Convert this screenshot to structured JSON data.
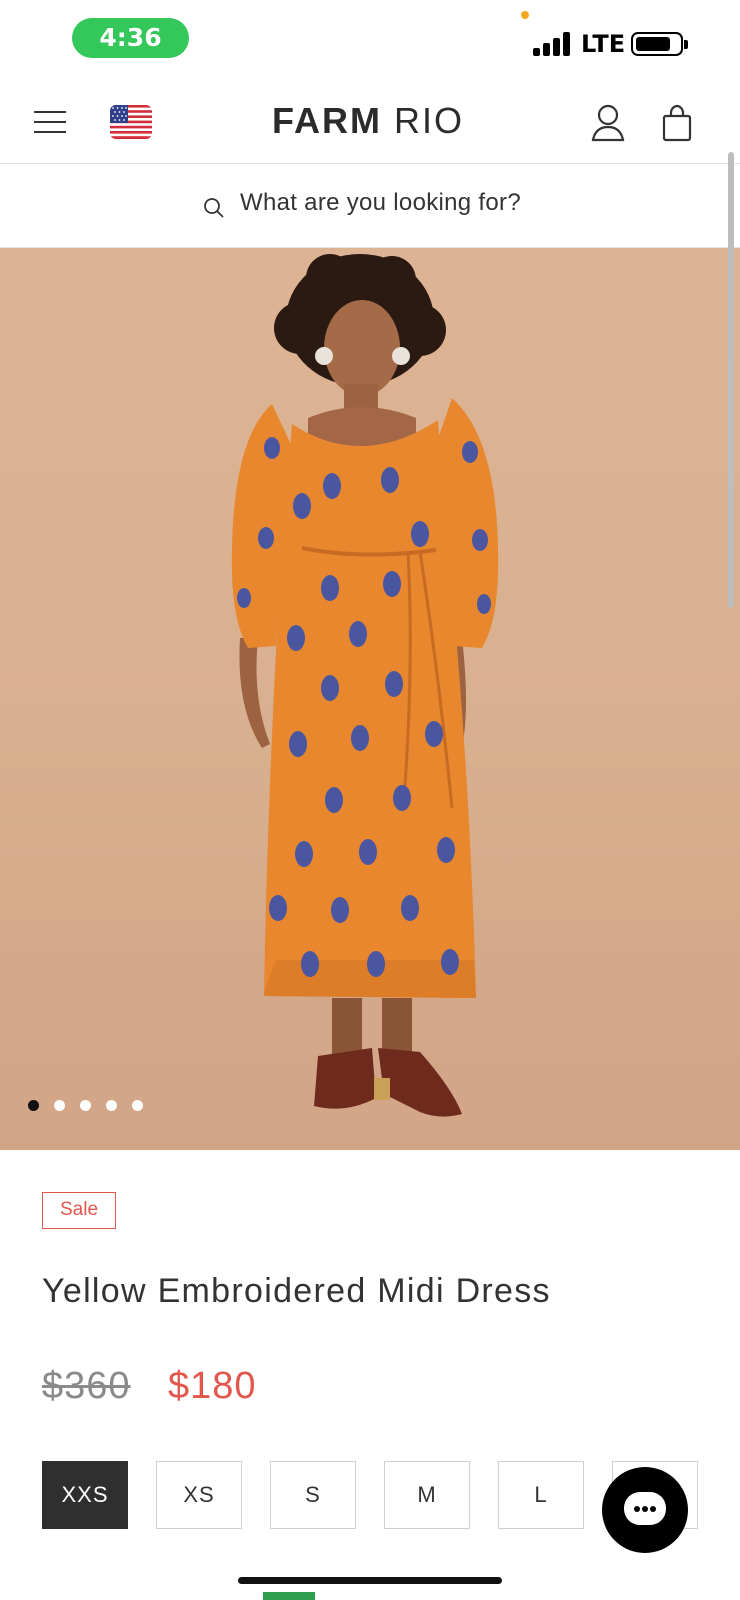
{
  "status_bar": {
    "time": "4:36",
    "network": "LTE"
  },
  "header": {
    "brand_bold": "FARM",
    "brand_light": "RIO",
    "icons": [
      "menu-icon",
      "us-flag-icon",
      "account-icon",
      "shopping-bag-icon"
    ]
  },
  "search": {
    "placeholder": "What are you looking for?"
  },
  "gallery": {
    "slide_count": 5,
    "active_index": 0
  },
  "product": {
    "badge": "Sale",
    "title": "Yellow Embroidered Midi Dress",
    "price_original": "$360",
    "price_sale": "$180",
    "sizes": [
      {
        "label": "XXS",
        "selected": true
      },
      {
        "label": "XS",
        "selected": false
      },
      {
        "label": "S",
        "selected": false
      },
      {
        "label": "M",
        "selected": false
      },
      {
        "label": "L",
        "selected": false
      },
      {
        "label": "",
        "selected": false
      }
    ]
  },
  "colors": {
    "accent_sale": "#e2574c",
    "time_pill": "#34c759",
    "dress": "#e8872e"
  }
}
